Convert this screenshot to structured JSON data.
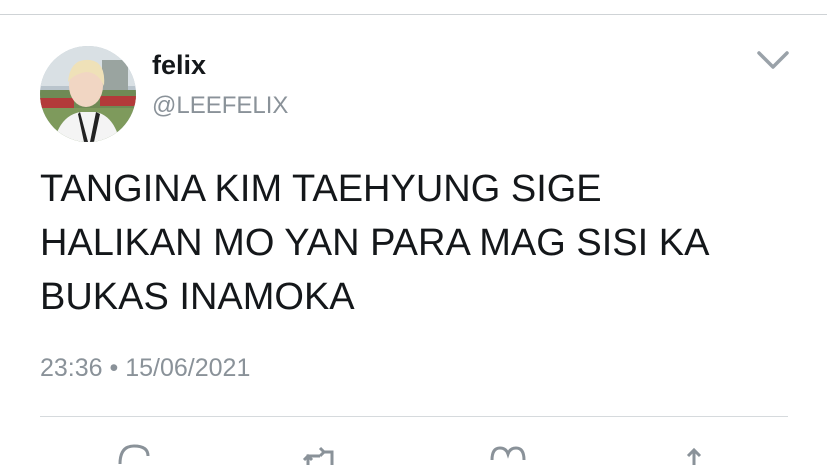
{
  "tweet": {
    "display_name": "felix",
    "handle": "@LEEFELIX",
    "text_lines": [
      "TANGINA KIM TAEHYUNG SIGE",
      "HALIKAN MO YAN PARA MAG SISI KA",
      "BUKAS INAMOKA"
    ],
    "time": "23:36",
    "separator": "•",
    "date": "15/06/2021"
  },
  "icons": {
    "menu": "chevron-down-icon",
    "reply": "reply-icon",
    "retweet": "retweet-icon",
    "like": "heart-icon",
    "share": "share-icon"
  },
  "colors": {
    "text": "#14171a",
    "secondary": "#8a9299",
    "divider": "#d6dadd",
    "icon": "#8a9299"
  }
}
